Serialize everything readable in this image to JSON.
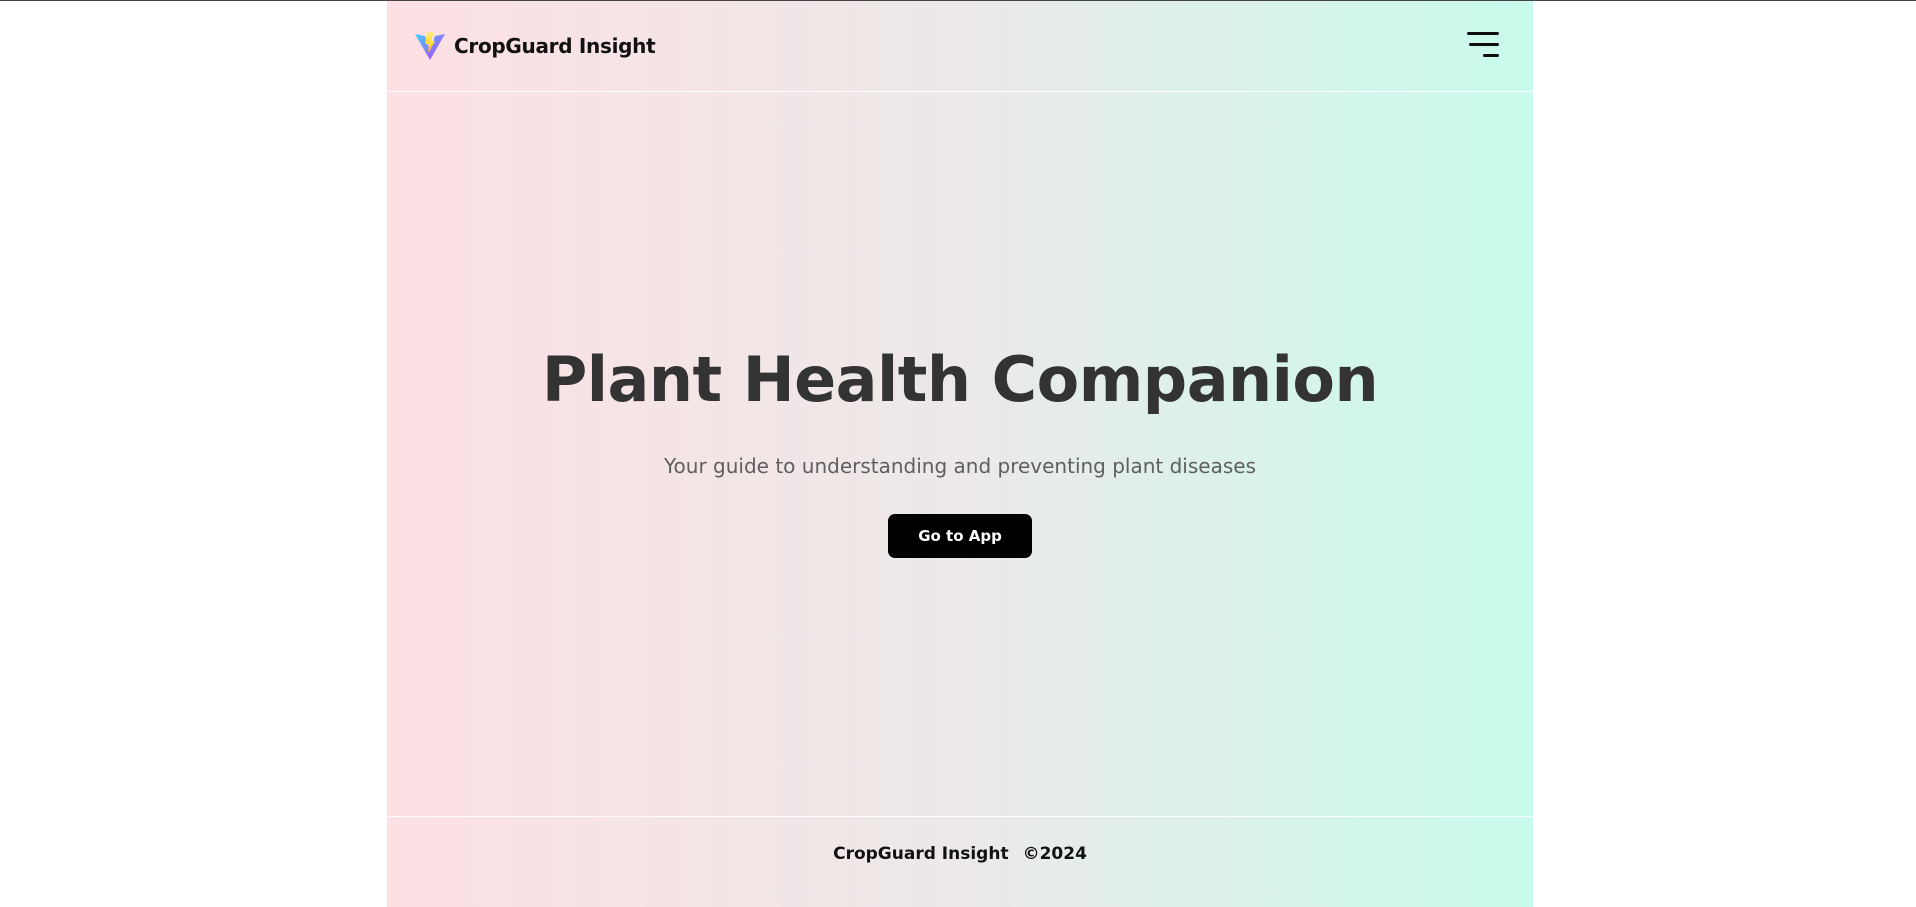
{
  "header": {
    "brand_name": "CropGuard Insight",
    "logo_icon": "vite-logo-icon",
    "menu_icon": "hamburger-menu-icon"
  },
  "hero": {
    "title": "Plant Health Companion",
    "subtitle": "Your guide to understanding and preventing plant diseases",
    "cta_label": "Go to App"
  },
  "footer": {
    "brand_name": "CropGuard Insight",
    "copyright": "©2024"
  },
  "colors": {
    "gradient_left": "#fde0e4",
    "gradient_mid": "#ece9e8",
    "gradient_right": "#c8fbec",
    "title_text": "#333333",
    "subtitle_text": "#5f5f5f",
    "button_bg": "#000000",
    "button_text": "#ffffff"
  }
}
